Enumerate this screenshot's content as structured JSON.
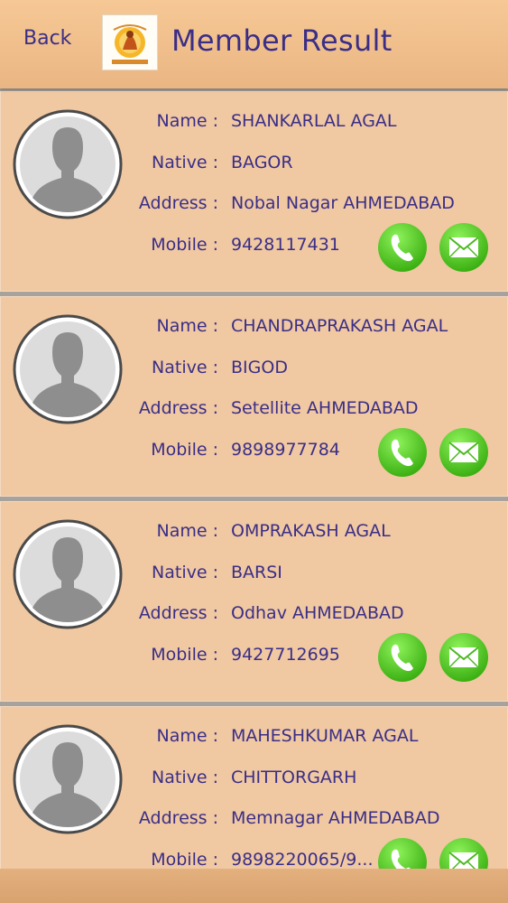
{
  "header": {
    "back_label": "Back",
    "title": "Member Result"
  },
  "labels": {
    "name": "Name :",
    "native": "Native :",
    "address": "Address :",
    "mobile": "Mobile :"
  },
  "members": [
    {
      "name": "SHANKARLAL AGAL",
      "native": "BAGOR",
      "address": "Nobal Nagar AHMEDABAD",
      "mobile": "9428117431"
    },
    {
      "name": "CHANDRAPRAKASH AGAL",
      "native": "BIGOD",
      "address": "Setellite AHMEDABAD",
      "mobile": "9898977784"
    },
    {
      "name": "OMPRAKASH AGAL",
      "native": "BARSI",
      "address": "Odhav AHMEDABAD",
      "mobile": "9427712695"
    },
    {
      "name": "MAHESHKUMAR AGAL",
      "native": "CHITTORGARH",
      "address": "Memnagar AHMEDABAD",
      "mobile": "9898220065/9..."
    }
  ],
  "icons": {
    "call": "phone-icon",
    "message": "envelope-icon",
    "avatar": "person-silhouette-icon"
  },
  "colors": {
    "header_bg": "#f0c090",
    "card_bg": "#f0c8a2",
    "text": "#3a2e86",
    "button_green": "#4cc21c"
  }
}
